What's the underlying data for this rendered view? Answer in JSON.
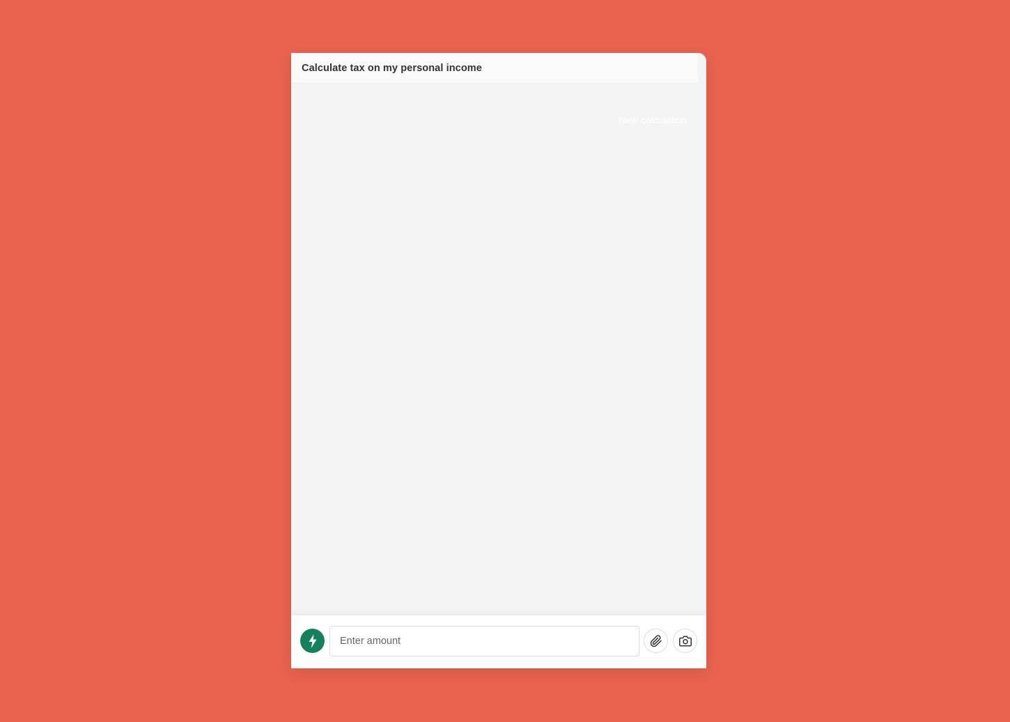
{
  "page": {
    "background_color": "#e9634f"
  },
  "header": {
    "title": "Calculate tax on my personal income"
  },
  "messages": {
    "new_calculation_label": "New calculation",
    "new_calculation_color": "#ffffff"
  },
  "composer": {
    "amount_placeholder": "Enter amount",
    "amount_value": "",
    "bolt_button_color": "#15805c",
    "bolt_icon": "lightning-bolt-icon",
    "attach_icon": "paperclip-icon",
    "camera_icon": "camera-icon"
  }
}
